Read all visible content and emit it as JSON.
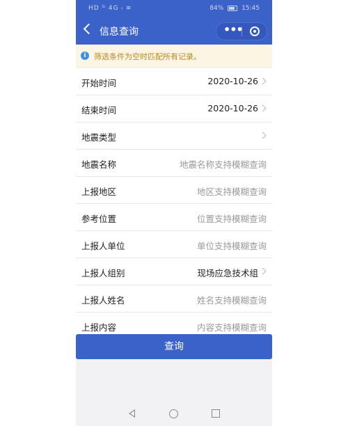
{
  "status_bar": {
    "left": "HD ᴳ 4G ᵢ ≋",
    "battery": "84%",
    "time": "15:45"
  },
  "nav": {
    "title": "信息查询",
    "more_icon": "more-dots-icon",
    "close_icon": "target-circle-icon"
  },
  "notice": {
    "icon": "info-icon",
    "text": "筛选条件为空时匹配所有记录。"
  },
  "form": {
    "rows": [
      {
        "label": "开始时间",
        "value": "2020-10-26",
        "arrow": true
      },
      {
        "label": "结束时间",
        "value": "2020-10-26",
        "arrow": true
      },
      {
        "label": "地震类型",
        "value": "",
        "arrow": true
      },
      {
        "label": "地震名称",
        "placeholder": "地震名称支持模糊查询"
      },
      {
        "label": "上报地区",
        "placeholder": "地区支持模糊查询"
      },
      {
        "label": "参考位置",
        "placeholder": "位置支持模糊查询"
      },
      {
        "label": "上报人单位",
        "placeholder": "单位支持模糊查询"
      },
      {
        "label": "上报人组别",
        "value": "现场应急技术组",
        "arrow": true
      },
      {
        "label": "上报人姓名",
        "placeholder": "姓名支持模糊查询"
      },
      {
        "label": "上报内容",
        "placeholder": "内容支持模糊查询"
      }
    ]
  },
  "query_button": "查询",
  "colors": {
    "primary": "#3b62c8",
    "notice_bg": "#fdf5e3",
    "notice_text": "#b98a22"
  }
}
